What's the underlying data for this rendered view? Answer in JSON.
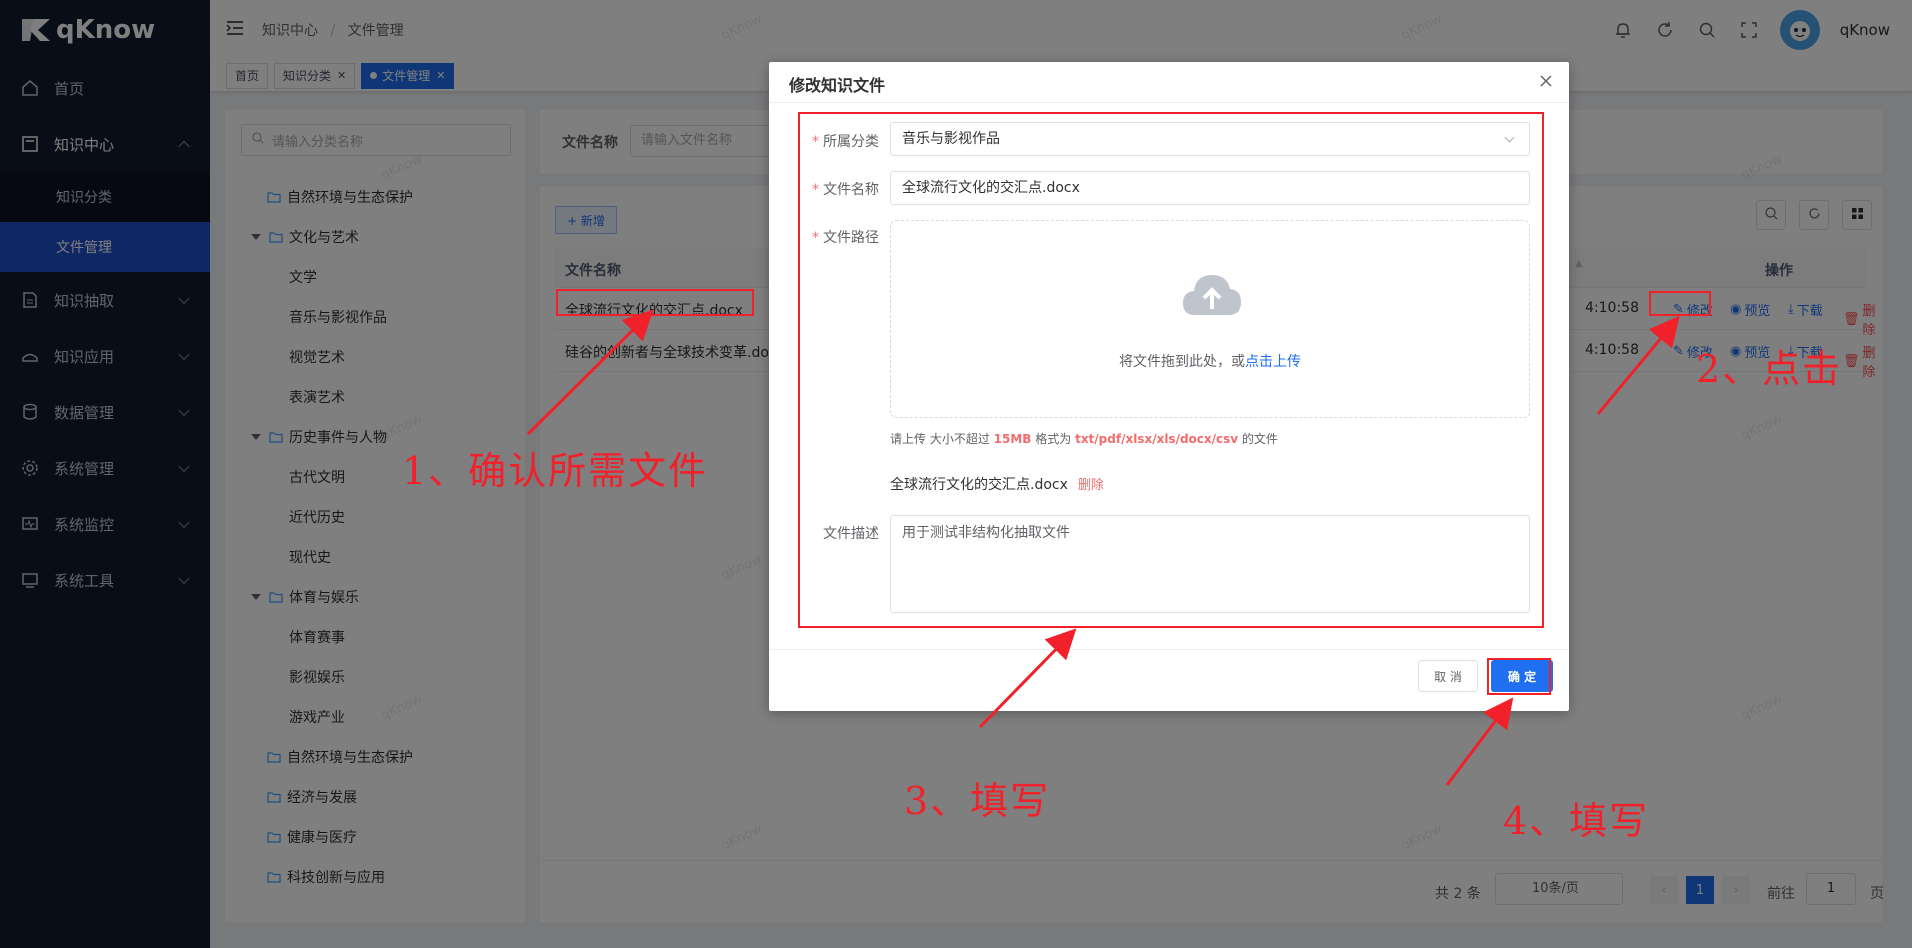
{
  "app": {
    "logo": "qKnow"
  },
  "sidebar": {
    "items": [
      {
        "label": "首页",
        "icon": "home-icon"
      },
      {
        "label": "知识中心",
        "icon": "book-icon",
        "open": true,
        "children": [
          {
            "label": "知识分类"
          },
          {
            "label": "文件管理",
            "active": true
          }
        ]
      },
      {
        "label": "知识抽取",
        "icon": "extract-icon"
      },
      {
        "label": "知识应用",
        "icon": "app-icon"
      },
      {
        "label": "数据管理",
        "icon": "database-icon"
      },
      {
        "label": "系统管理",
        "icon": "gear-icon"
      },
      {
        "label": "系统监控",
        "icon": "monitor-icon"
      },
      {
        "label": "系统工具",
        "icon": "tools-icon"
      }
    ]
  },
  "header": {
    "breadcrumb": [
      "知识中心",
      "/",
      "文件管理"
    ],
    "username": "qKnow"
  },
  "tags": [
    "首页",
    "知识分类",
    "文件管理"
  ],
  "tree": {
    "search_placeholder": "请输入分类名称",
    "nodes": [
      "自然环境与生态保护",
      "文化与艺术",
      "文学",
      "音乐与影视作品",
      "视觉艺术",
      "表演艺术",
      "历史事件与人物",
      "古代文明",
      "近代历史",
      "现代史",
      "体育与娱乐",
      "体育赛事",
      "影视娱乐",
      "游戏产业",
      "自然环境与生态保护",
      "经济与发展",
      "健康与医疗",
      "科技创新与应用"
    ]
  },
  "search": {
    "label": "文件名称",
    "placeholder": "请输入文件名称"
  },
  "table": {
    "add_label": "+ 新增",
    "col_name": "文件名称",
    "col_ops": "操作",
    "rows": [
      {
        "name": "全球流行文化的交汇点.docx",
        "time": "4:10:58"
      },
      {
        "name": "硅谷的创新者与全球技术变革.docx",
        "time": "4:10:58"
      }
    ],
    "ops": {
      "edit": "修改",
      "preview": "预览",
      "download": "下载",
      "delete": "删除"
    }
  },
  "pager": {
    "total": "共 2 条",
    "size": "10条/页",
    "current": "1",
    "goto": "前往",
    "goto_value": "1",
    "page_unit": "页"
  },
  "dialog": {
    "title": "修改知识文件",
    "category_label": "所属分类",
    "category_value": "音乐与影视作品",
    "name_label": "文件名称",
    "name_value": "全球流行文化的交汇点.docx",
    "path_label": "文件路径",
    "upload_text": "将文件拖到此处，或",
    "upload_link": "点击上传",
    "tip_prefix": "请上传 大小不超过 ",
    "tip_size": "15MB",
    "tip_mid": " 格式为 ",
    "tip_formats": "txt/pdf/xlsx/xls/docx/csv",
    "tip_suffix": " 的文件",
    "uploaded_file": "全球流行文化的交汇点.docx",
    "uploaded_delete": "删除",
    "desc_label": "文件描述",
    "desc_value": "用于测试非结构化抽取文件",
    "cancel": "取 消",
    "ok": "确 定"
  },
  "annotations": {
    "step1": "1、确认所需文件",
    "step2": "2、点击",
    "step3": "3、填写",
    "step4": "4、填写"
  },
  "watermark": "qKnow",
  "colors": {
    "primary": "#1f6ff0",
    "sidebar": "#111a2e",
    "annotation": "#f0212a"
  }
}
